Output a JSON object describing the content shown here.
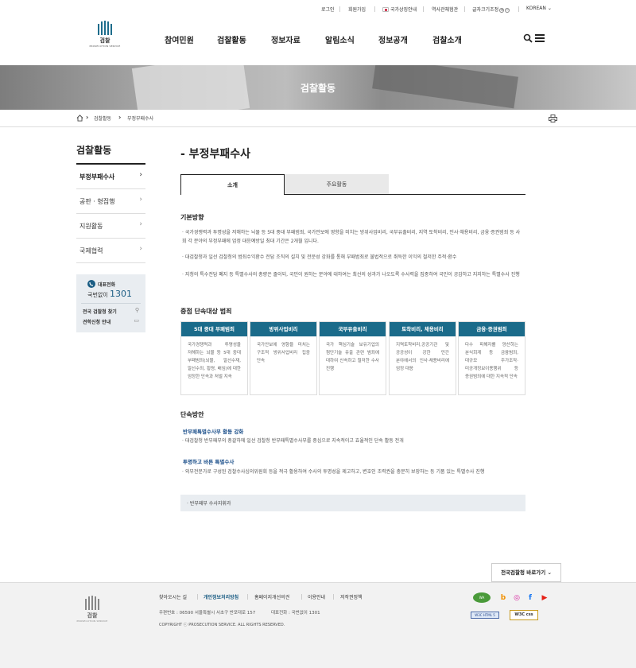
{
  "util": {
    "items": [
      "로그인",
      "회원가입",
      "국가상징안내",
      "역사관체험관",
      "글자크기조정",
      "KOREAN"
    ],
    "font_plus": "+",
    "font_minus": "−"
  },
  "logo": {
    "kr": "검찰",
    "en": "PROSECUTION SERVICE"
  },
  "gnb": [
    "참여민원",
    "검찰활동",
    "정보자료",
    "알림소식",
    "정보공개",
    "검찰소개"
  ],
  "banner": {
    "title": "검찰활동"
  },
  "breadcrumb": [
    "검찰활동",
    "부정부패수사"
  ],
  "sidebar": {
    "title": "검찰활동",
    "items": [
      {
        "label": "부정부패수사"
      },
      {
        "label": "공판 · 형집행"
      },
      {
        "label": "지원활동"
      },
      {
        "label": "국제협력"
      }
    ],
    "call_title": "대표전화",
    "call_prefix": "국번없이",
    "call_number": "1301",
    "link1": "전국 검찰청 찾기",
    "link2": "견학신청 안내"
  },
  "main": {
    "title": "- 부정부패수사",
    "tabs": [
      "소개",
      "주요활동"
    ],
    "basic_title": "기본방향",
    "basic_paras": [
      "· 국가경쟁력과 투명성을 저해하는 뇌물 등 5대 중대 부패범죄, 국가안보에 영향을 미치는 방위사업비리, 국부유출비리, 지역 토착비리, 인사·채용비리, 금융·증권범죄 등 사회 각 분야의 부정부패에 엄정 대응예방일 최대 기간은 2개월 입니다.",
      "· 대검찰청과 일선 검찰청의 범죄수익환수 전담 조직의 설치 및 전문성 강화를 통해 부패범죄로 불법적으로 취득한 이익의 철저한 주적·환수",
      "· 지청의 특수전담 폐지 등 특별수사의 총량은 줄이되, 국민이 원하는 분야에 대하여는 최선의 성과가 나오도록 수사력을 집중하여 국민이 공감하고 지지하는 특별수사 진행"
    ],
    "focus_title": "중점 단속대상 범죄",
    "cards": [
      {
        "head": "5대 중대 부패범죄",
        "body": "국가경쟁력과 투명성을 저해하는 뇌물 등 5대 중대 부패범죄(뇌물, 알선수재, 알선수죄, 횡령, 배임)에 대한 엄정한 단속과 처벌 지속"
      },
      {
        "head": "방위사업비리",
        "body": "국가안보에 영향을 미치는 구조적 방위사업비리 집중 단속"
      },
      {
        "head": "국부유출비리",
        "body": "국가 핵심기술 보유기업의 첨단기술 유출 관련 범죄에 대하여 신속하고 철저한 수사 진행"
      },
      {
        "head": "토착비리, 채용비리",
        "body": "지역토착비리,공공기관 및 공공성이 강한 민간 분야에서의 인사·채용비리에 엄정 대응"
      },
      {
        "head": "금융·증권범죄",
        "body": "다수 피해자를 양산하는 분식회계 등 금융범죄, 대규모 주가조작·미공개정보이용행위 등 증권범죄에 대한 지속적 단속"
      }
    ],
    "method_title": "단속방안",
    "method1_title": "반부패특별수사부 활동 강화",
    "method1_body": "· 대검찰청 반부패부의 총괄하에 일선 검찰청 반부패특별수사부를 중심으로 지속적이고 효율적인 단속 활동 전개",
    "method2_title": "투명하고 바른 특별수사",
    "method2_body": "· 외부전문가로 구성된 검찰수사심의위원회 등을 적극 활용하여 수사의 투명성을 제고하고, 변호인 조력권을 충분히 보장하는 등 기품 있는 특별수사 진행",
    "gray_box": "· 반부패부 수사지휘과"
  },
  "shortcut": "전국검찰청 바로가기",
  "footer": {
    "links": [
      "찾아오시는 길",
      "개인정보처리방침",
      "홈페이지개선의견",
      "이용안내",
      "저작권정책"
    ],
    "addr": "우편번호 : 06590 서울특별시 서초구 반포대로 157",
    "phone": "대표전화 : 국번없이 1301",
    "copyright": "COPYRIGHT ⓒ PROSECUTION SERVICE. ALL RIGHTS RESERVED.",
    "badge1": "W3C HTML 5",
    "badge2": "W3C css"
  },
  "colors": {
    "accent": "#1b6b8a",
    "navy": "#1b4f8a"
  }
}
